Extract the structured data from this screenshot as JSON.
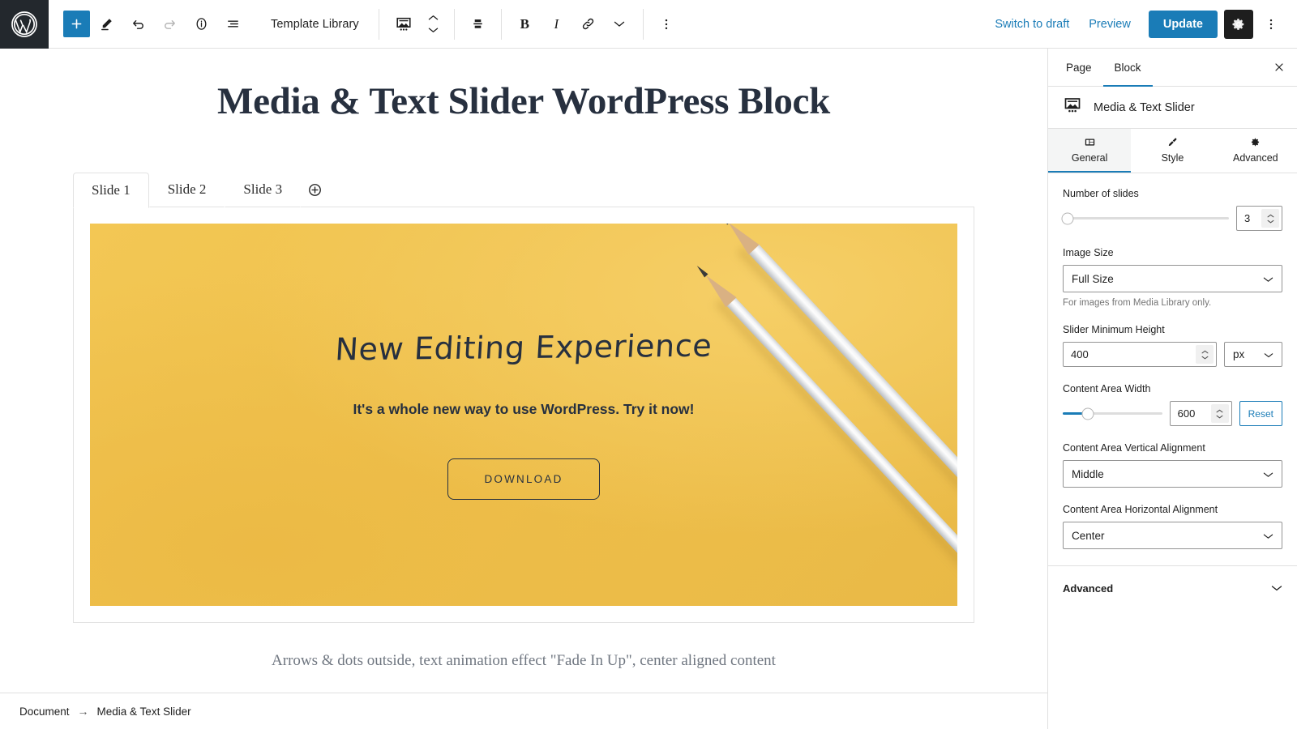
{
  "topbar": {
    "logo_icon": "wordpress-logo",
    "add_block_label": "+",
    "icons": [
      "add-block-icon",
      "edit-pencil-icon",
      "undo-icon",
      "redo-icon",
      "info-icon",
      "list-view-icon"
    ],
    "template_library_label": "Template Library",
    "block_icon": "media-text-slider-icon",
    "move_up_icon": "chevron-up-icon",
    "move_down_icon": "chevron-down-icon",
    "align_icon": "vertical-align-icon",
    "bold_label": "B",
    "italic_label": "I",
    "link_icon": "link-icon",
    "more_rich_text_icon": "chevron-down-icon",
    "options_icon": "kebab-menu-icon",
    "switch_to_draft_label": "Switch to draft",
    "preview_label": "Preview",
    "update_label": "Update",
    "settings_icon": "gear-icon",
    "more_options_icon": "kebab-menu-icon"
  },
  "canvas": {
    "post_title": "Media & Text Slider WordPress Block",
    "tabs": [
      {
        "label": "Slide 1",
        "active": true
      },
      {
        "label": "Slide 2",
        "active": false
      },
      {
        "label": "Slide 3",
        "active": false
      }
    ],
    "add_tab_icon": "plus-circle-icon",
    "slide": {
      "background_color": "#f0c14f",
      "heading": "New Editing Experience",
      "paragraph": "It's a whole new way to use WordPress. Try it now!",
      "button_label": "DOWNLOAD"
    },
    "caption": "Arrows & dots outside, text animation effect \"Fade In Up\", center aligned content"
  },
  "footer": {
    "breadcrumb_root": "Document",
    "breadcrumb_arrow": "→",
    "breadcrumb_current": "Media & Text Slider"
  },
  "sidebar": {
    "tabs": [
      {
        "label": "Page",
        "active": false
      },
      {
        "label": "Block",
        "active": true
      }
    ],
    "close_icon": "close-icon",
    "block_name": "Media & Text Slider",
    "block_icon": "media-text-slider-icon",
    "sections": [
      {
        "label": "General",
        "icon": "layout-icon",
        "active": true
      },
      {
        "label": "Style",
        "icon": "brush-icon",
        "active": false
      },
      {
        "label": "Advanced",
        "icon": "gear-icon",
        "active": false
      }
    ],
    "fields": {
      "number_of_slides": {
        "label": "Number of slides",
        "value": "3",
        "slider_percent": 2
      },
      "image_size": {
        "label": "Image Size",
        "value": "Full Size",
        "help": "For images from Media Library only."
      },
      "slider_minimum_height": {
        "label": "Slider Minimum Height",
        "value": "400",
        "unit": "px"
      },
      "content_area_width": {
        "label": "Content Area Width",
        "value": "600",
        "slider_percent": 25,
        "reset_label": "Reset"
      },
      "content_area_vertical_alignment": {
        "label": "Content Area Vertical Alignment",
        "value": "Middle"
      },
      "content_area_horizontal_alignment": {
        "label": "Content Area Horizontal Alignment",
        "value": "Center"
      }
    },
    "advanced_accordion": {
      "label": "Advanced"
    }
  },
  "colors": {
    "accent_blue": "#1a7cb7",
    "slide_yellow": "#f0c14f",
    "dark_navy": "#27303f"
  }
}
